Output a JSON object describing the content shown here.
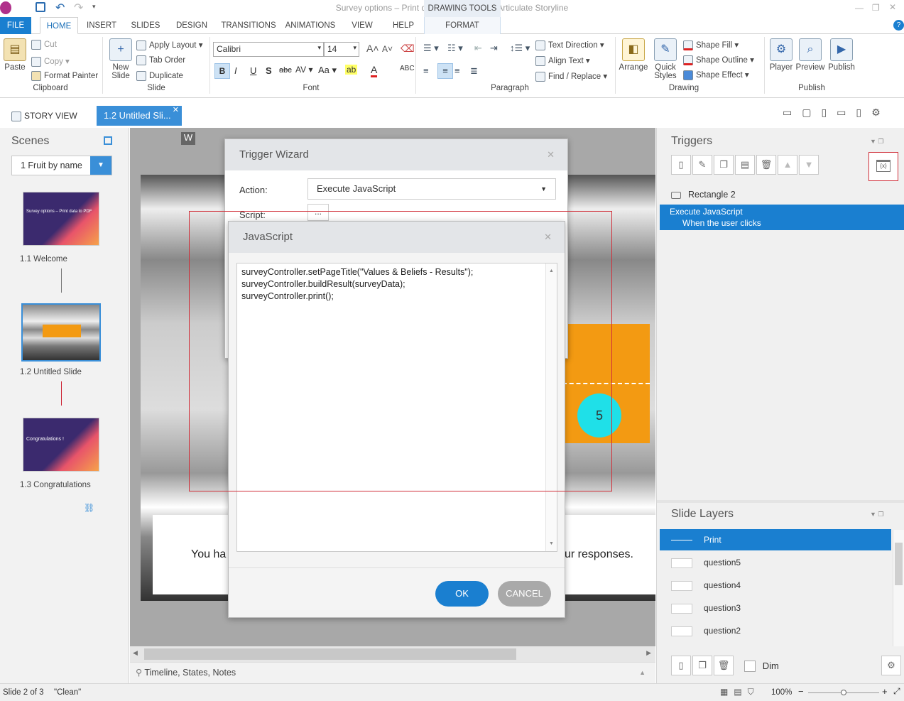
{
  "window": {
    "title": "Survey options – Print data to PDF.story* - Articulate Storyline"
  },
  "ribbon_tabs": [
    "FILE",
    "HOME",
    "INSERT",
    "SLIDES",
    "DESIGN",
    "TRANSITIONS",
    "ANIMATIONS",
    "VIEW",
    "HELP"
  ],
  "contextual": {
    "group": "DRAWING TOOLS",
    "tab": "FORMAT"
  },
  "clipboard": {
    "paste": "Paste",
    "cut": "Cut",
    "copy": "Copy",
    "format_painter": "Format Painter",
    "label": "Clipboard"
  },
  "slide_group": {
    "new_slide": "New Slide",
    "apply_layout": "Apply Layout",
    "tab_order": "Tab Order",
    "duplicate": "Duplicate",
    "label": "Slide"
  },
  "font": {
    "family": "Calibri",
    "size": "14",
    "label": "Font"
  },
  "paragraph": {
    "text_direction": "Text Direction",
    "align_text": "Align Text",
    "find_replace": "Find / Replace",
    "label": "Paragraph"
  },
  "drawing": {
    "arrange": "Arrange",
    "quick_styles": "Quick Styles",
    "shape_fill": "Shape Fill",
    "shape_outline": "Shape Outline",
    "shape_effect": "Shape Effect",
    "label": "Drawing"
  },
  "publish": {
    "player": "Player",
    "preview": "Preview",
    "publish": "Publish",
    "label": "Publish"
  },
  "doc_tabs": {
    "story_view": "STORY VIEW",
    "active": "1.2 Untitled Sli..."
  },
  "scenes": {
    "title": "Scenes",
    "selector": "1 Fruit by name",
    "slides": [
      {
        "label": "1.1 Welcome",
        "thumb_title": "Survey options – Print data to PDF"
      },
      {
        "label": "1.2 Untitled Slide"
      },
      {
        "label": "1.3 Congratulations",
        "thumb_title": "Congratulations !"
      }
    ]
  },
  "canvas": {
    "badge": "W",
    "circle_number": "5",
    "text_left": "You ha",
    "text_right": "ur responses."
  },
  "trigger_wizard": {
    "title": "Trigger Wizard",
    "action_label": "Action:",
    "action_value": "Execute JavaScript",
    "script_label": "Script:",
    "script_button": "..."
  },
  "js_dialog": {
    "title": "JavaScript",
    "code": [
      "surveyController.setPageTitle(\"Values & Beliefs - Results\");",
      "surveyController.buildResult(surveyData);",
      "surveyController.print();"
    ],
    "ok": "OK",
    "cancel": "CANCEL"
  },
  "triggers": {
    "title": "Triggers",
    "object": "Rectangle 2",
    "selected_action": "Execute JavaScript",
    "selected_condition": "When the user clicks"
  },
  "slide_layers": {
    "title": "Slide Layers",
    "items": [
      "Print",
      "question5",
      "question4",
      "question3",
      "question2"
    ],
    "dim": "Dim"
  },
  "timeline_bar": "Timeline, States, Notes",
  "status": {
    "slide": "Slide 2 of 3",
    "state": "\"Clean\"",
    "zoom": "100%"
  },
  "colors": {
    "accent": "#3a8fd8",
    "ok": "#1a7fd0",
    "cancel": "#a9a9a9",
    "orange": "#f39a12",
    "cyan": "#1fe0e8",
    "highlight_box": "#d0303a"
  }
}
